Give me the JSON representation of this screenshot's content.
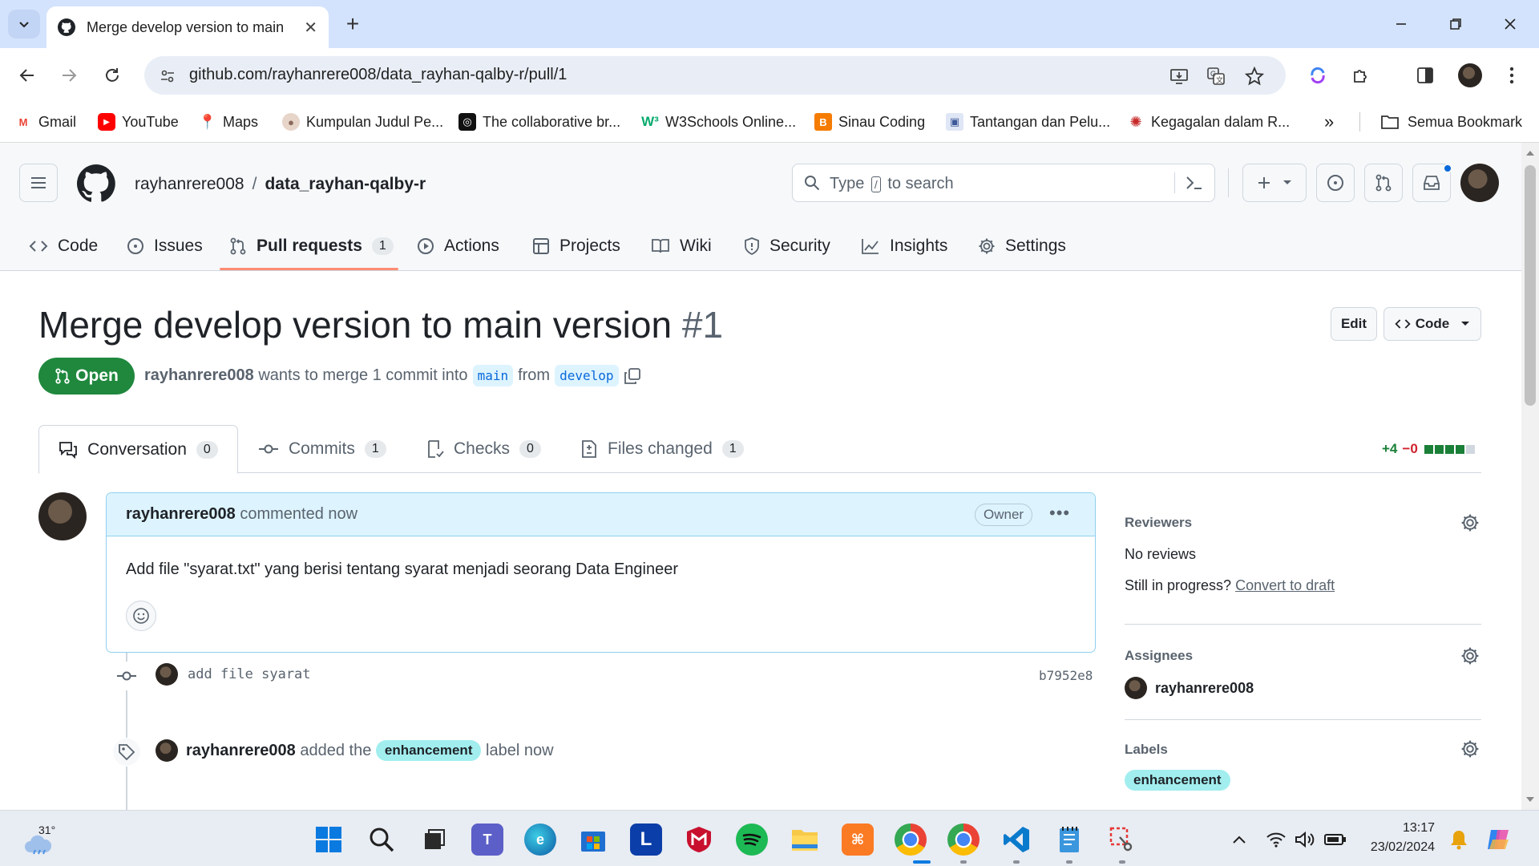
{
  "browser": {
    "tab_title": "Merge develop version to main version #1",
    "url": "github.com/rayhanrere008/data_rayhan-qalby-r/pull/1",
    "bookmarks": [
      {
        "label": "Gmail",
        "icon": "gmail-icon",
        "color": "#ea4335",
        "glyph": "M"
      },
      {
        "label": "YouTube",
        "icon": "youtube-icon",
        "color": "#ff0000",
        "glyph": "▶"
      },
      {
        "label": "Maps",
        "icon": "maps-icon",
        "color": "#34a853",
        "glyph": "◆"
      },
      {
        "label": "Kumpulan Judul Pe...",
        "icon": "site-favicon-icon",
        "color": "#8a6a5a",
        "glyph": "●"
      },
      {
        "label": "The collaborative br...",
        "icon": "site-favicon-icon",
        "color": "#111111",
        "glyph": "◎"
      },
      {
        "label": "W3Schools Online...",
        "icon": "w3schools-icon",
        "color": "#04aa6d",
        "glyph": "W"
      },
      {
        "label": "Sinau Coding",
        "icon": "blogger-icon",
        "color": "#f57c00",
        "glyph": "B"
      },
      {
        "label": "Tantangan dan Pelu...",
        "icon": "site-favicon-icon",
        "color": "#3b5998",
        "glyph": "▣"
      },
      {
        "label": "Kegagalan dalam R...",
        "icon": "site-favicon-icon",
        "color": "#c62828",
        "glyph": "✺"
      }
    ],
    "all_bookmarks_label": "Semua Bookmark"
  },
  "header": {
    "owner": "rayhanrere008",
    "separator": "/",
    "repo": "data_rayhan-qalby-r",
    "search_before": "Type",
    "search_key": "/",
    "search_after": "to search"
  },
  "repo_nav": [
    {
      "label": "Code",
      "icon": "code-icon"
    },
    {
      "label": "Issues",
      "icon": "issue-opened-icon"
    },
    {
      "label": "Pull requests",
      "icon": "git-pull-request-icon",
      "count": "1",
      "selected": true
    },
    {
      "label": "Actions",
      "icon": "play-icon"
    },
    {
      "label": "Projects",
      "icon": "table-icon"
    },
    {
      "label": "Wiki",
      "icon": "book-icon"
    },
    {
      "label": "Security",
      "icon": "shield-icon"
    },
    {
      "label": "Insights",
      "icon": "graph-icon"
    },
    {
      "label": "Settings",
      "icon": "gear-icon"
    }
  ],
  "pr": {
    "title": "Merge develop version to main version",
    "number": "#1",
    "edit_label": "Edit",
    "code_label": "Code",
    "state": "Open",
    "author": "rayhanrere008",
    "merge_text_1": "wants to merge 1 commit into",
    "base_branch": "main",
    "merge_text_2": "from",
    "head_branch": "develop"
  },
  "pr_tabs": [
    {
      "label": "Conversation",
      "count": "0",
      "icon": "comment-discussion-icon"
    },
    {
      "label": "Commits",
      "count": "1",
      "icon": "git-commit-icon"
    },
    {
      "label": "Checks",
      "count": "0",
      "icon": "checklist-icon"
    },
    {
      "label": "Files changed",
      "count": "1",
      "icon": "file-diff-icon"
    }
  ],
  "diffstat": {
    "additions": "+4",
    "deletions": "−0",
    "colors": [
      "#1a7f37",
      "#1a7f37",
      "#1a7f37",
      "#1a7f37",
      "#d0d7de"
    ]
  },
  "comment": {
    "author": "rayhanrere008",
    "action": "commented now",
    "badge": "Owner",
    "body": "Add file \"syarat.txt\" yang berisi tentang syarat menjadi seorang Data Engineer"
  },
  "timeline": {
    "commit_message": "add file syarat",
    "commit_sha": "b7952e8",
    "label_event_user": "rayhanrere008",
    "label_event_text_1": "added the",
    "label_event_label": "enhancement",
    "label_event_text_2": "label now"
  },
  "sidebar": {
    "reviewers_title": "Reviewers",
    "reviewers_value": "No reviews",
    "in_progress_text": "Still in progress?",
    "convert_link": "Convert to draft",
    "assignees_title": "Assignees",
    "assignee": "rayhanrere008",
    "labels_title": "Labels",
    "label": "enhancement"
  },
  "taskbar": {
    "weather_temp": "31°",
    "time": "13:17",
    "date": "23/02/2024"
  }
}
